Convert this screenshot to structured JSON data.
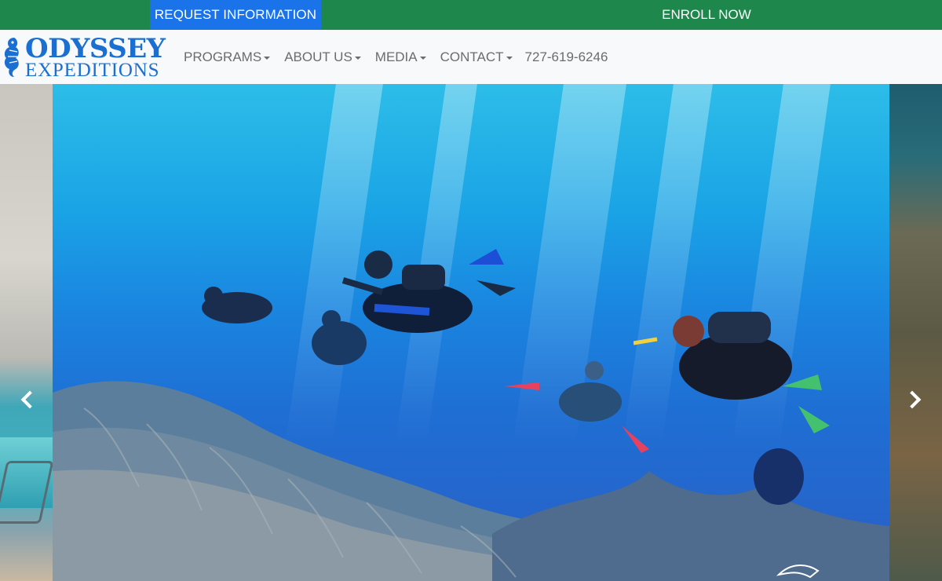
{
  "top_bar": {
    "request_label": "REQUEST INFORMATION",
    "enroll_label": "ENROLL NOW"
  },
  "logo": {
    "line1": "ODYSSEY",
    "line2": "EXPEDITIONS"
  },
  "nav": {
    "items": [
      {
        "label": "PROGRAMS",
        "dropdown": true
      },
      {
        "label": "ABOUT US",
        "dropdown": true
      },
      {
        "label": "MEDIA",
        "dropdown": true
      },
      {
        "label": "CONTACT",
        "dropdown": true
      }
    ],
    "phone": "727-619-6246"
  },
  "carousel": {
    "prev_icon": "chevron-left-icon",
    "next_icon": "chevron-right-icon",
    "main_slide": "scuba-divers-over-reef-photo"
  },
  "colors": {
    "top_bar": "#1e874b",
    "request_button": "#1a73e8",
    "brand_blue": "#1a6fd0",
    "nav_text": "#6c6c6c",
    "navbar_bg": "#f8f9fa"
  }
}
